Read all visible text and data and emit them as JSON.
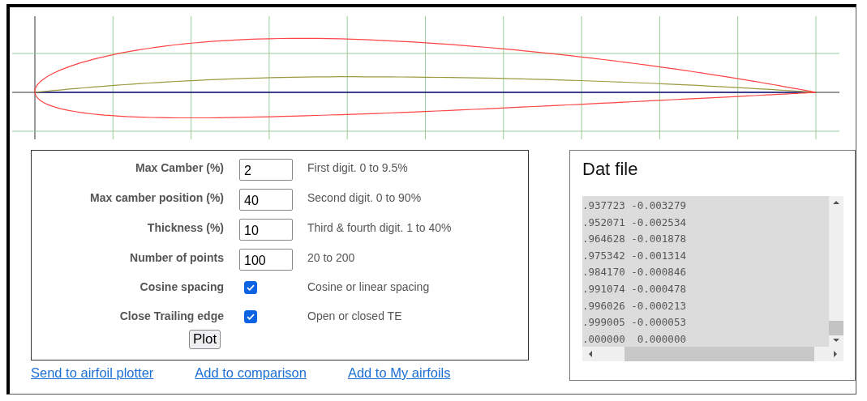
{
  "params": [
    {
      "kind": "number",
      "label": "Max Camber (%)",
      "value": "2",
      "hint": "First digit. 0 to 9.5%"
    },
    {
      "kind": "number",
      "label": "Max camber position (%)",
      "value": "40",
      "hint": "Second digit. 0 to 90%"
    },
    {
      "kind": "number",
      "label": "Thickness (%)",
      "value": "10",
      "hint": "Third & fourth digit. 1 to 40%"
    },
    {
      "kind": "number",
      "label": "Number of points",
      "value": "100",
      "hint": "20 to 200"
    },
    {
      "kind": "checkbox",
      "label": "Cosine spacing",
      "checked": true,
      "hint": "Cosine or linear spacing"
    },
    {
      "kind": "checkbox",
      "label": "Close Trailing edge",
      "checked": true,
      "hint": "Open or closed TE"
    }
  ],
  "plot_button": "Plot",
  "links": [
    "Send to airfoil plotter",
    "Add to comparison",
    "Add to My airfoils"
  ],
  "dat": {
    "title": "Dat file",
    "lines": [
      ".937723 -0.003279",
      ".952071 -0.002534",
      ".964628 -0.001878",
      ".975342 -0.001314",
      ".984170 -0.000846",
      ".991074 -0.000478",
      ".996026 -0.000213",
      ".999005 -0.000053",
      ".000000  0.000000"
    ]
  }
}
